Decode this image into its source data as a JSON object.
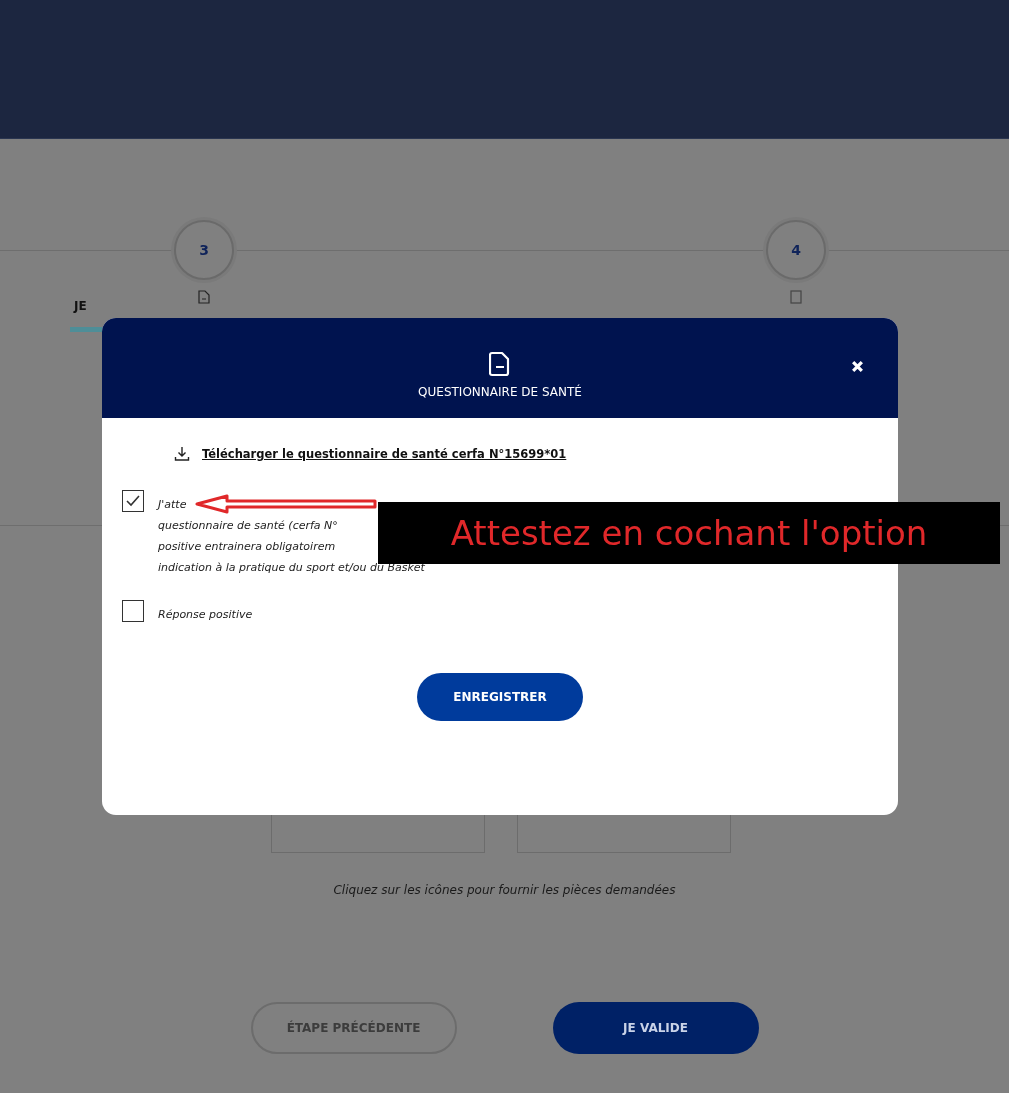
{
  "steps": [
    {
      "number": "3",
      "kind": "document"
    },
    {
      "number": "4",
      "kind": "square"
    }
  ],
  "tabs": [
    {
      "label": "JE",
      "selected": true
    }
  ],
  "upload_caption": "Cliquez sur les icônes pour fournir les pièces demandées",
  "buttons": [
    {
      "label": "ÉTAPE PRÉCÉDENTE",
      "disabled": true
    },
    {
      "label": "JE VALIDE",
      "disabled": false
    }
  ],
  "modal": {
    "title": "QUESTIONNAIRE DE SANTÉ",
    "download_link": "Télécharger le questionnaire de santé cerfa N°15699*01",
    "options": [
      {
        "lines": [
          "J'atte",
          "questionnaire de santé (cerfa N°",
          "positive entrainera obligatoirem",
          "indication à la pratique du sport et/ou du Basket"
        ],
        "checked": true
      },
      {
        "lines": [
          "Réponse positive"
        ],
        "checked": false
      }
    ],
    "save_button": "ENREGISTRER"
  },
  "annotation": {
    "text": "Attestez en cochant l'option"
  }
}
